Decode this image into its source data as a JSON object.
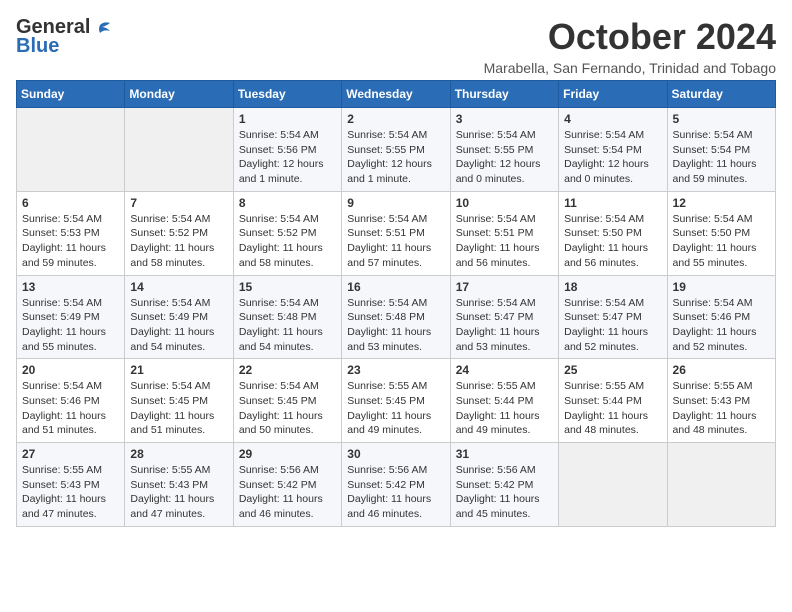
{
  "logo": {
    "text_general": "General",
    "text_blue": "Blue"
  },
  "title": "October 2024",
  "location": "Marabella, San Fernando, Trinidad and Tobago",
  "days_header": [
    "Sunday",
    "Monday",
    "Tuesday",
    "Wednesday",
    "Thursday",
    "Friday",
    "Saturday"
  ],
  "weeks": [
    [
      {
        "day": "",
        "info": ""
      },
      {
        "day": "",
        "info": ""
      },
      {
        "day": "1",
        "info": "Sunrise: 5:54 AM\nSunset: 5:56 PM\nDaylight: 12 hours\nand 1 minute."
      },
      {
        "day": "2",
        "info": "Sunrise: 5:54 AM\nSunset: 5:55 PM\nDaylight: 12 hours\nand 1 minute."
      },
      {
        "day": "3",
        "info": "Sunrise: 5:54 AM\nSunset: 5:55 PM\nDaylight: 12 hours\nand 0 minutes."
      },
      {
        "day": "4",
        "info": "Sunrise: 5:54 AM\nSunset: 5:54 PM\nDaylight: 12 hours\nand 0 minutes."
      },
      {
        "day": "5",
        "info": "Sunrise: 5:54 AM\nSunset: 5:54 PM\nDaylight: 11 hours\nand 59 minutes."
      }
    ],
    [
      {
        "day": "6",
        "info": "Sunrise: 5:54 AM\nSunset: 5:53 PM\nDaylight: 11 hours\nand 59 minutes."
      },
      {
        "day": "7",
        "info": "Sunrise: 5:54 AM\nSunset: 5:52 PM\nDaylight: 11 hours\nand 58 minutes."
      },
      {
        "day": "8",
        "info": "Sunrise: 5:54 AM\nSunset: 5:52 PM\nDaylight: 11 hours\nand 58 minutes."
      },
      {
        "day": "9",
        "info": "Sunrise: 5:54 AM\nSunset: 5:51 PM\nDaylight: 11 hours\nand 57 minutes."
      },
      {
        "day": "10",
        "info": "Sunrise: 5:54 AM\nSunset: 5:51 PM\nDaylight: 11 hours\nand 56 minutes."
      },
      {
        "day": "11",
        "info": "Sunrise: 5:54 AM\nSunset: 5:50 PM\nDaylight: 11 hours\nand 56 minutes."
      },
      {
        "day": "12",
        "info": "Sunrise: 5:54 AM\nSunset: 5:50 PM\nDaylight: 11 hours\nand 55 minutes."
      }
    ],
    [
      {
        "day": "13",
        "info": "Sunrise: 5:54 AM\nSunset: 5:49 PM\nDaylight: 11 hours\nand 55 minutes."
      },
      {
        "day": "14",
        "info": "Sunrise: 5:54 AM\nSunset: 5:49 PM\nDaylight: 11 hours\nand 54 minutes."
      },
      {
        "day": "15",
        "info": "Sunrise: 5:54 AM\nSunset: 5:48 PM\nDaylight: 11 hours\nand 54 minutes."
      },
      {
        "day": "16",
        "info": "Sunrise: 5:54 AM\nSunset: 5:48 PM\nDaylight: 11 hours\nand 53 minutes."
      },
      {
        "day": "17",
        "info": "Sunrise: 5:54 AM\nSunset: 5:47 PM\nDaylight: 11 hours\nand 53 minutes."
      },
      {
        "day": "18",
        "info": "Sunrise: 5:54 AM\nSunset: 5:47 PM\nDaylight: 11 hours\nand 52 minutes."
      },
      {
        "day": "19",
        "info": "Sunrise: 5:54 AM\nSunset: 5:46 PM\nDaylight: 11 hours\nand 52 minutes."
      }
    ],
    [
      {
        "day": "20",
        "info": "Sunrise: 5:54 AM\nSunset: 5:46 PM\nDaylight: 11 hours\nand 51 minutes."
      },
      {
        "day": "21",
        "info": "Sunrise: 5:54 AM\nSunset: 5:45 PM\nDaylight: 11 hours\nand 51 minutes."
      },
      {
        "day": "22",
        "info": "Sunrise: 5:54 AM\nSunset: 5:45 PM\nDaylight: 11 hours\nand 50 minutes."
      },
      {
        "day": "23",
        "info": "Sunrise: 5:55 AM\nSunset: 5:45 PM\nDaylight: 11 hours\nand 49 minutes."
      },
      {
        "day": "24",
        "info": "Sunrise: 5:55 AM\nSunset: 5:44 PM\nDaylight: 11 hours\nand 49 minutes."
      },
      {
        "day": "25",
        "info": "Sunrise: 5:55 AM\nSunset: 5:44 PM\nDaylight: 11 hours\nand 48 minutes."
      },
      {
        "day": "26",
        "info": "Sunrise: 5:55 AM\nSunset: 5:43 PM\nDaylight: 11 hours\nand 48 minutes."
      }
    ],
    [
      {
        "day": "27",
        "info": "Sunrise: 5:55 AM\nSunset: 5:43 PM\nDaylight: 11 hours\nand 47 minutes."
      },
      {
        "day": "28",
        "info": "Sunrise: 5:55 AM\nSunset: 5:43 PM\nDaylight: 11 hours\nand 47 minutes."
      },
      {
        "day": "29",
        "info": "Sunrise: 5:56 AM\nSunset: 5:42 PM\nDaylight: 11 hours\nand 46 minutes."
      },
      {
        "day": "30",
        "info": "Sunrise: 5:56 AM\nSunset: 5:42 PM\nDaylight: 11 hours\nand 46 minutes."
      },
      {
        "day": "31",
        "info": "Sunrise: 5:56 AM\nSunset: 5:42 PM\nDaylight: 11 hours\nand 45 minutes."
      },
      {
        "day": "",
        "info": ""
      },
      {
        "day": "",
        "info": ""
      }
    ]
  ]
}
